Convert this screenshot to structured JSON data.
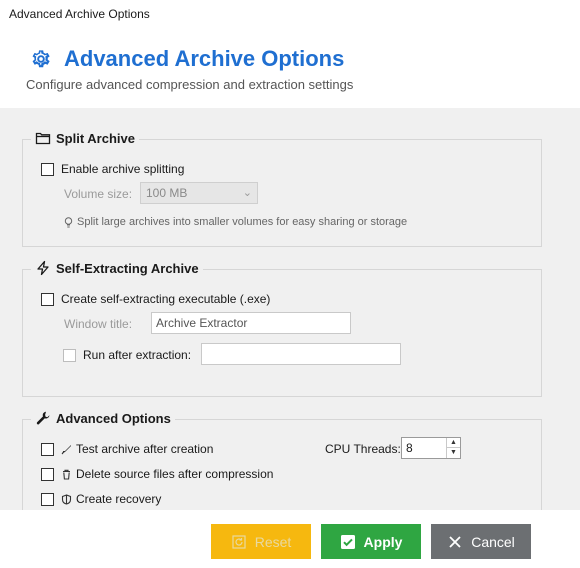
{
  "window": {
    "title": "Advanced Archive Options"
  },
  "header": {
    "title": "Advanced Archive Options",
    "subtitle": "Configure advanced compression and extraction settings",
    "accent_color": "#1f6fd1"
  },
  "split": {
    "title": "Split Archive",
    "enable_label": "Enable archive splitting",
    "volume_label": "Volume size:",
    "volume_value": "100 MB",
    "hint": "Split large archives into smaller volumes for easy sharing or storage"
  },
  "sfx": {
    "title": "Self-Extracting Archive",
    "create_label": "Create self-extracting executable (.exe)",
    "window_title_label": "Window title:",
    "window_title_value": "Archive Extractor",
    "run_after_label": "Run after extraction:",
    "run_after_value": ""
  },
  "advanced": {
    "title": "Advanced Options",
    "test_label": "Test archive after creation",
    "delete_label": "Delete source files after compression",
    "recovery_label": "Create recovery",
    "cpu_label": "CPU Threads:",
    "cpu_value": "8"
  },
  "footer": {
    "reset_label": "Reset",
    "apply_label": "Apply",
    "cancel_label": "Cancel",
    "reset_color": "#f6b80f",
    "apply_color": "#2fa642",
    "cancel_color": "#6c6f72"
  }
}
